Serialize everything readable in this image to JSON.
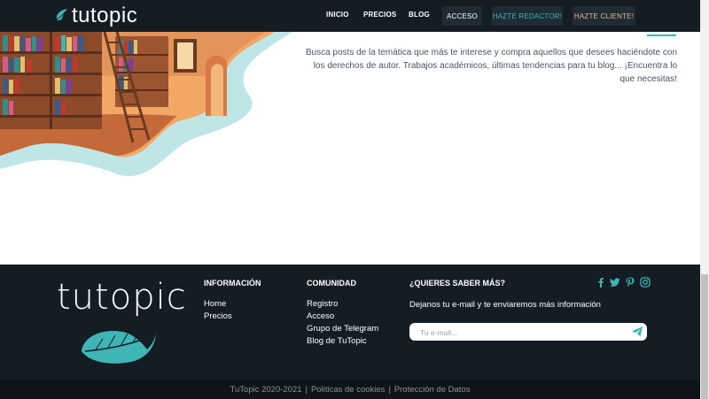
{
  "nav": {
    "logo": "tutopic",
    "links": [
      "INICIO",
      "PRECIOS",
      "BLOG"
    ],
    "acceso": "ACCESO",
    "redactor": "HAZTE REDACTOR!",
    "cliente": "HAZTE CLIENTE!"
  },
  "hero": {
    "text": "Busca posts de la temática que más te interese y compra aquellos que desees haciéndote con los derechos de autor. Trabajos académicos, últimas tendencias para tu blog... ¡Encuentra lo que necesitas!"
  },
  "footer": {
    "logo": "tutopic",
    "informacion": {
      "title": "INFORMACIÓN",
      "links": [
        "Home",
        "Precios"
      ]
    },
    "comunidad": {
      "title": "COMUNIDAD",
      "links": [
        "Registro",
        "Acceso",
        "Grupo de Telegram",
        "Blog de TuTopic"
      ]
    },
    "newsletter": {
      "title": "¿QUIERES SABER MÁS?",
      "desc": "Dejanos tu e-mail y te enviaremos más información",
      "placeholder": "Tu e-mail..."
    },
    "social_icons": [
      "facebook-icon",
      "twitter-icon",
      "pinterest-icon",
      "instagram-icon"
    ]
  },
  "bottom": {
    "copyright": "TuTopic 2020-2021",
    "sep": "|",
    "cookies": "Politicas de cookies",
    "privacy": "Protección de Datos"
  },
  "colors": {
    "dark": "#141c24",
    "accent": "#3fb5b5",
    "cliente": "#e8b48a"
  }
}
